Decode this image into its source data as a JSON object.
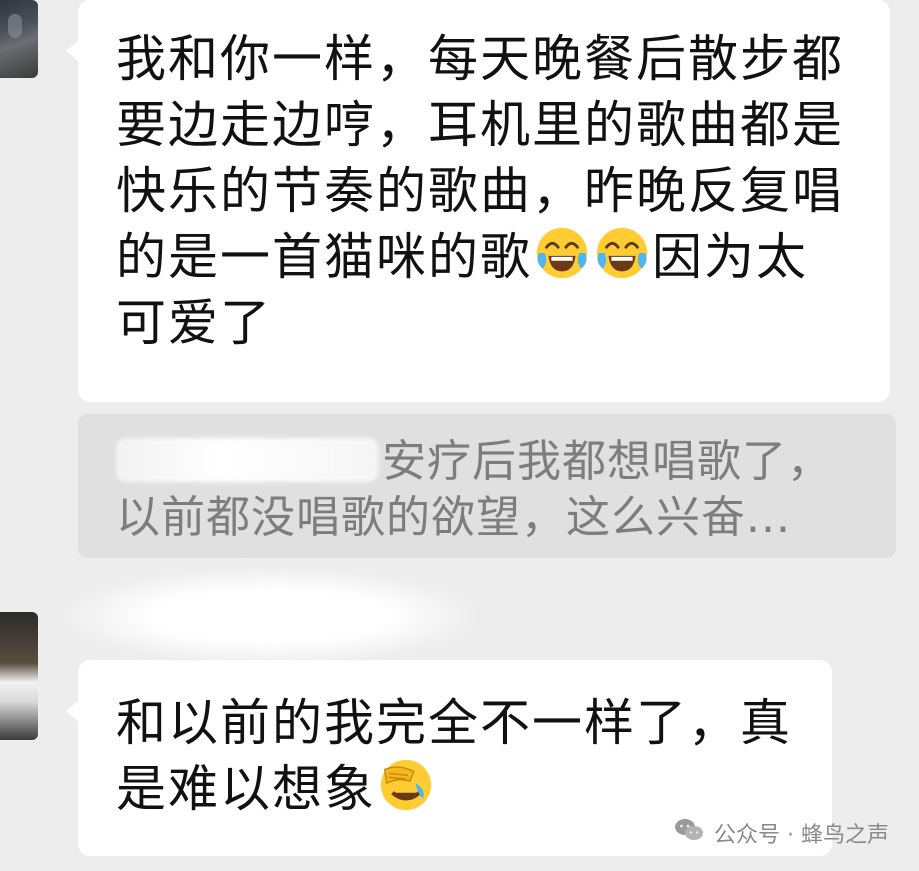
{
  "messages": [
    {
      "text": "我和你一样，每天晚餐后散步都要边走边哼，耳机里的歌曲都是快乐的节奏的歌曲，昨晚反复唱的是一首猫咪的歌",
      "after_emoji_text": "因为太可爱了",
      "emojis": [
        "tears-of-joy-icon",
        "tears-of-joy-icon"
      ]
    },
    {
      "quote_text": "安疗后我都想唱歌了，以前都没唱歌的欲望，这么兴奋..."
    },
    {
      "text": "和以前的我完全不一样了，真是难以想象",
      "emojis": [
        "face-palm-laugh-icon"
      ]
    }
  ],
  "watermark": {
    "label": "公众号 · 蜂鸟之声"
  },
  "colors": {
    "background": "#ededed",
    "bubble": "#ffffff",
    "quote_bg": "#e0e0e0",
    "quote_text": "#7d7d7d"
  }
}
